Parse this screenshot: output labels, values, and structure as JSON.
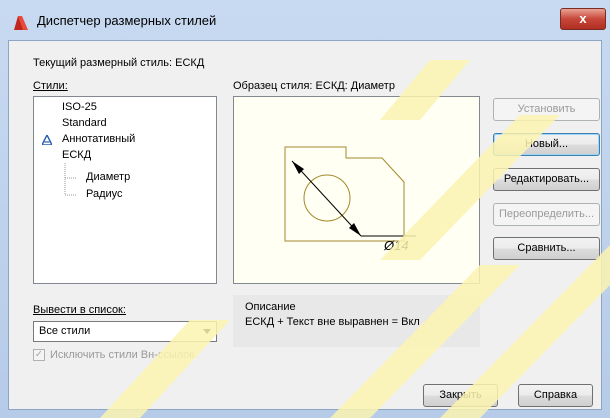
{
  "window": {
    "title": "Диспетчер размерных стилей",
    "close_symbol": "x"
  },
  "current_style": "Текущий размерный стиль: ЕСКД",
  "styles_label": "Стили:",
  "styles": [
    {
      "label": "ISO-25",
      "icon": ""
    },
    {
      "label": "Standard",
      "icon": ""
    },
    {
      "label": "Аннотативный",
      "icon": "annotative-icon"
    },
    {
      "label": "ЕСКД",
      "icon": ""
    },
    {
      "label": "Диаметр",
      "icon": "tree-branch"
    },
    {
      "label": "Радиус",
      "icon": "tree-branch"
    }
  ],
  "preview_label": "Образец стиля: ЕСКД: Диаметр",
  "preview_dimension_text": "Ø14",
  "buttons": {
    "set_current": "Установить",
    "new": "Новый...",
    "modify": "Редактировать...",
    "override": "Переопределить...",
    "compare": "Сравнить...",
    "close": "Закрыть",
    "help": "Справка"
  },
  "list_label": "Вывести в список:",
  "list_value": "Все стили",
  "exclude_xref": {
    "label": "Исключить стили Вн-ссылок",
    "checked": true,
    "enabled": false
  },
  "description_title": "Описание",
  "description_text": "ЕСКД + Текст вне выравнен = Вкл",
  "colors": {
    "preview_geometry": "#a58a2a",
    "title_bar": "#c8daf1",
    "watermark": "#fcf3b0"
  }
}
